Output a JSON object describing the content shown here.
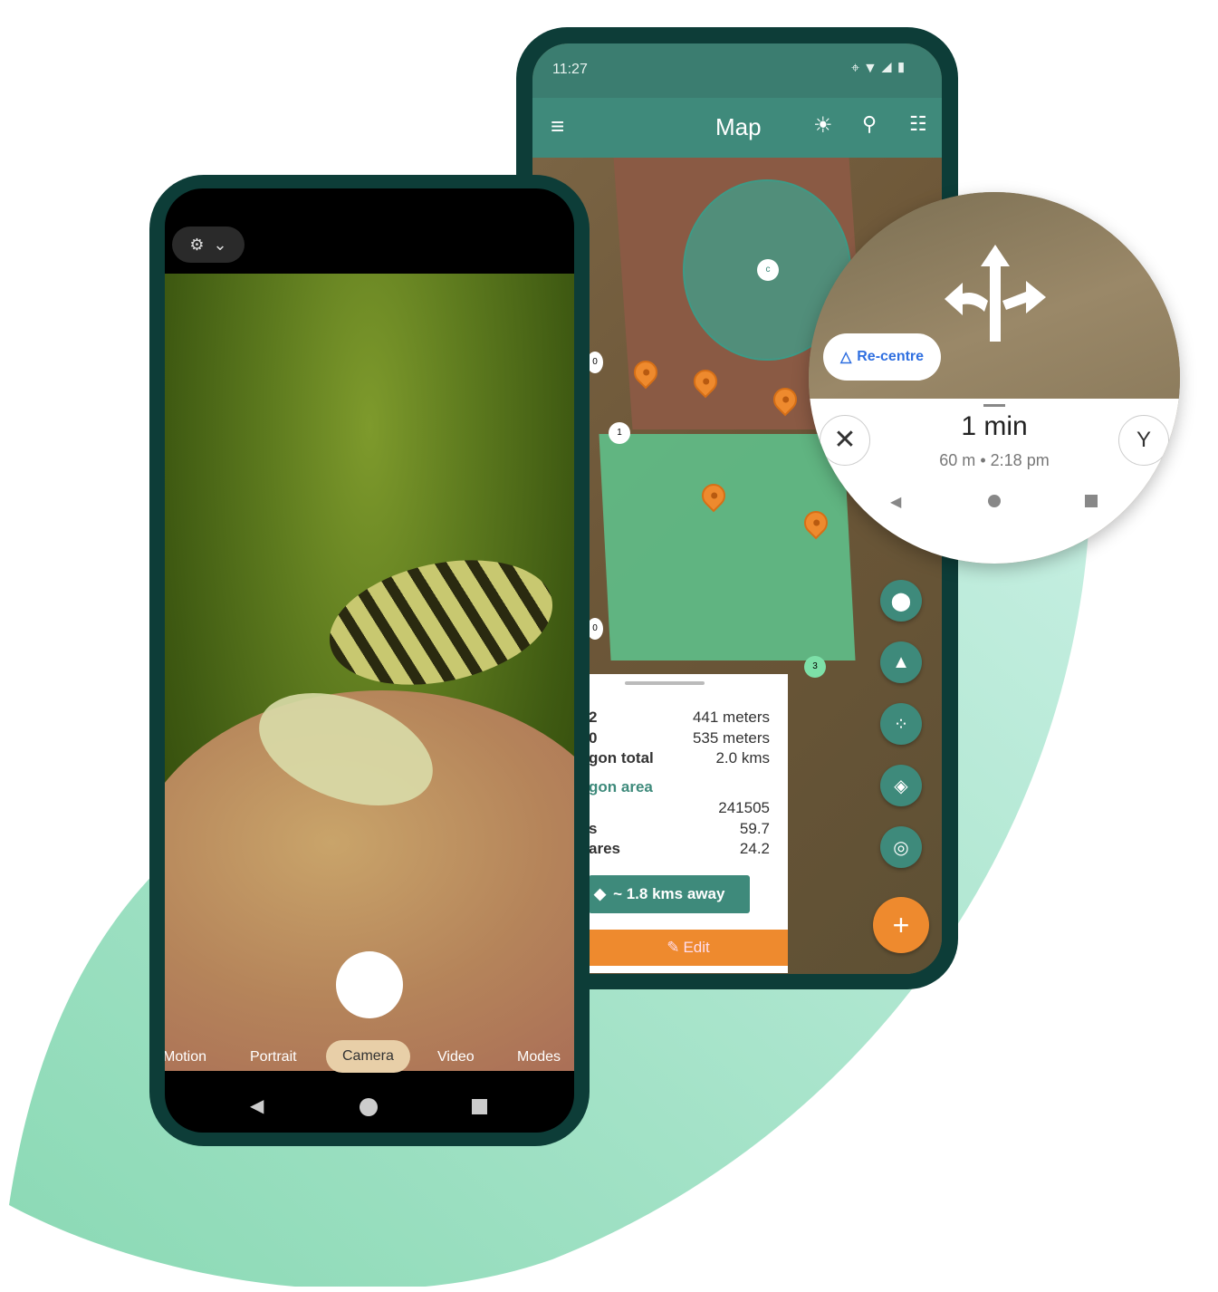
{
  "colors": {
    "brand": "#3f8a7b",
    "accent": "#ee8a2e",
    "frame": "#0d3d38",
    "blob": "#a8e4cc"
  },
  "map_phone": {
    "status_time": "11:27",
    "status_icons": [
      "location-icon",
      "wifi-icon",
      "signal-icon",
      "battery-icon"
    ],
    "title": "Map",
    "toolbar_icons": [
      "menu-icon",
      "brightness-icon",
      "search-icon",
      "tune-icon"
    ],
    "markers": [
      "c",
      "0",
      "1",
      "0",
      "3"
    ],
    "panel": {
      "rows": [
        {
          "label": "2",
          "value": "441 meters"
        },
        {
          "label": "0",
          "value": "535 meters"
        },
        {
          "label": "gon total",
          "value": "2.0 kms"
        }
      ],
      "section": "gon area",
      "area_rows": [
        {
          "label": "",
          "value": "241505"
        },
        {
          "label": "s",
          "value": "59.7"
        },
        {
          "label": "ares",
          "value": "24.2"
        }
      ],
      "directions_button": "~ 1.8 kms away",
      "edit_button": "Edit"
    },
    "fabs": [
      "pin-icon",
      "shapes-icon",
      "points-icon",
      "layers-icon",
      "my-location-icon",
      "add-icon"
    ]
  },
  "navigation": {
    "recentre": "Re-centre",
    "eta": "1 min",
    "distance": "60 m",
    "separator": "•",
    "arrival": "2:18 pm"
  },
  "camera_phone": {
    "modes": [
      "Motion",
      "Portrait",
      "Camera",
      "Video",
      "Modes"
    ],
    "selected_mode": "Camera"
  }
}
